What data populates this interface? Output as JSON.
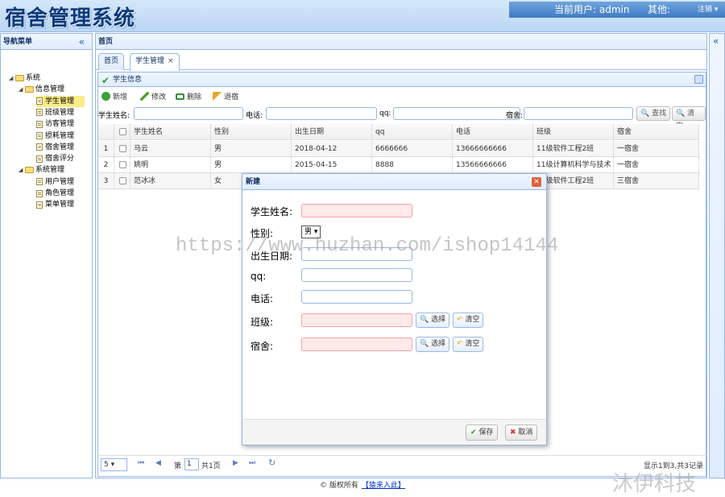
{
  "header": {
    "logo": "宿舍管理系统",
    "current_user": "当前用户: admin",
    "other": "其他:",
    "logout": "注销 ▾"
  },
  "nav": {
    "title": "导航菜单",
    "collapse": "«",
    "tree": [
      {
        "label": "系统",
        "type": "folder",
        "level": 0
      },
      {
        "label": "信息管理",
        "type": "folder",
        "level": 1
      },
      {
        "label": "学生管理",
        "type": "file",
        "level": 2,
        "selected": true
      },
      {
        "label": "班级管理",
        "type": "file",
        "level": 2
      },
      {
        "label": "访客管理",
        "type": "file",
        "level": 2
      },
      {
        "label": "损耗管理",
        "type": "file",
        "level": 2
      },
      {
        "label": "宿舍管理",
        "type": "file",
        "level": 2
      },
      {
        "label": "宿舍评分",
        "type": "file",
        "level": 2
      },
      {
        "label": "系统管理",
        "type": "folder",
        "level": 1
      },
      {
        "label": "用户管理",
        "type": "file",
        "level": 2
      },
      {
        "label": "角色管理",
        "type": "file",
        "level": 2
      },
      {
        "label": "菜单管理",
        "type": "file",
        "level": 2
      }
    ]
  },
  "east": {
    "expand": "«"
  },
  "center": {
    "title": "首页",
    "tabs": [
      {
        "label": "首页"
      },
      {
        "label": "学生管理",
        "close": "×"
      }
    ]
  },
  "grid": {
    "title": "学生信息",
    "toolbar": {
      "add": "新增",
      "edit": "修改",
      "delete": "删除",
      "checkout": "退宿"
    },
    "search": {
      "name_label": "学生姓名:",
      "phone_label": "电话:",
      "qq_label": "qq:",
      "dorm_label": "宿舍:",
      "search_btn": "查找",
      "clear_btn": "清空"
    },
    "columns": [
      "学生姓名",
      "性别",
      "出生日期",
      "qq",
      "电话",
      "班级",
      "宿舍"
    ],
    "rows": [
      {
        "num": "1",
        "cells": [
          "马云",
          "男",
          "2018-04-12",
          "6666666",
          "13666666666",
          "11级软件工程2班",
          "一宿舍"
        ]
      },
      {
        "num": "2",
        "cells": [
          "姚明",
          "男",
          "2015-04-15",
          "8888",
          "13566666666",
          "11级计算机科学与技术",
          "一宿舍"
        ]
      },
      {
        "num": "3",
        "cells": [
          "范冰冰",
          "女",
          "",
          "",
          "",
          "11级软件工程2班",
          "三宿舍"
        ]
      }
    ]
  },
  "pager": {
    "page_size": "5 ▾",
    "first": "⏮",
    "prev": "◀",
    "page_label": "第",
    "page": "1",
    "total_pages": "共1页",
    "next": "▶",
    "last": "⏭",
    "refresh": "↻",
    "summary": "显示1到3,共3记录"
  },
  "dialog": {
    "title": "新建",
    "close": "✕",
    "fields": {
      "name": "学生姓名:",
      "gender": "性别:",
      "gender_value": "男 ▾",
      "birth": "出生日期:",
      "qq": "qq:",
      "phone": "电话:",
      "clazz": "班级:",
      "dorm": "宿舍:"
    },
    "select_btn": "选择",
    "clear_btn": "清空",
    "save": "保存",
    "cancel": "取消"
  },
  "footer": {
    "copyright": "© 版权所有",
    "link": "【猿来入此】"
  },
  "watermark": "https://www.huzhan.com/ishop14144",
  "brand_watermark": "沐伊科技"
}
